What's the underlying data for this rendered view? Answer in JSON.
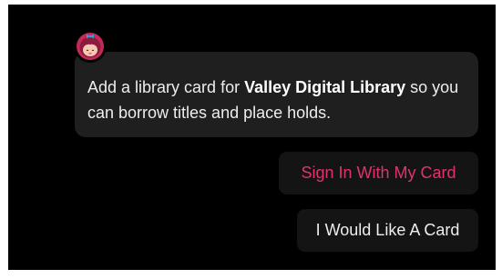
{
  "avatar": {
    "icon": "librarian-mascot-icon",
    "colors": {
      "ring": "#c22a58",
      "face": "#f6c9b0",
      "hair": "#8c1c3e",
      "bow": "#2ea3d6"
    }
  },
  "message": {
    "text_before": "Add a library card for ",
    "library_name": "Valley Digital Library",
    "text_after": " so you can borrow titles and place holds."
  },
  "actions": {
    "sign_in_label": "Sign In With My Card",
    "request_card_label": "I Would Like A Card"
  },
  "colors": {
    "background": "#000000",
    "card": "#1f1f1f",
    "accent": "#e0336e",
    "text": "#ededed"
  }
}
